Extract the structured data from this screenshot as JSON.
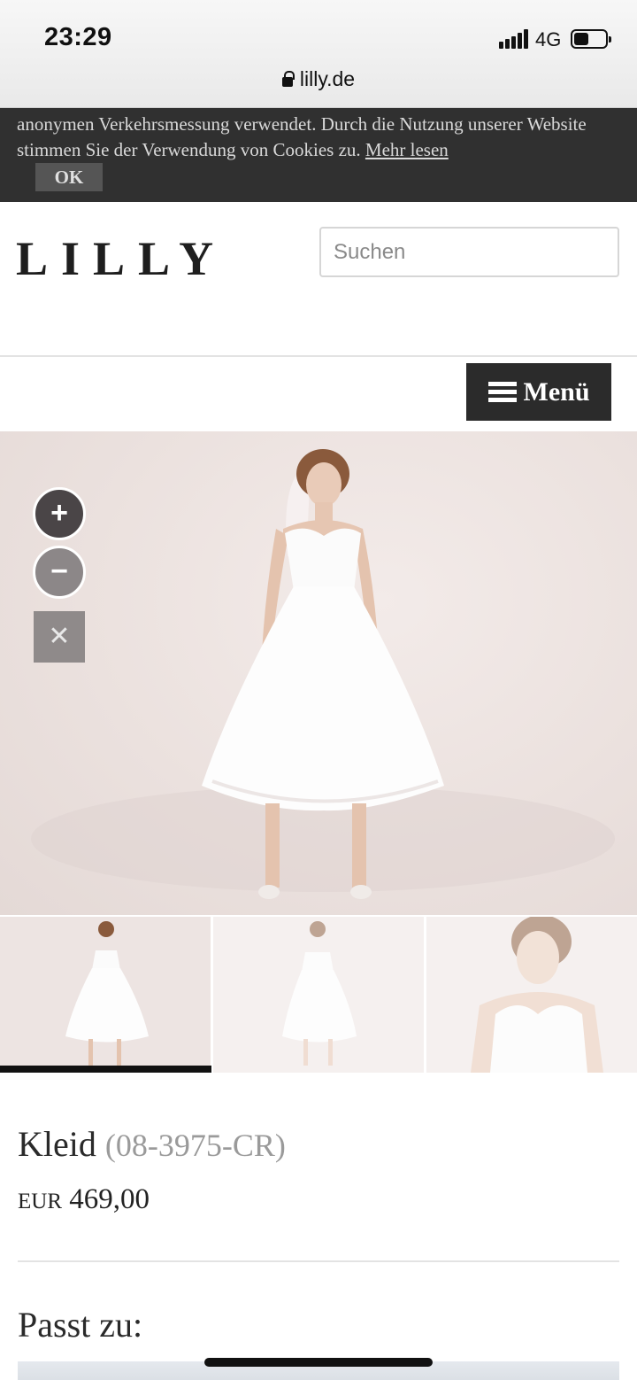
{
  "status_bar": {
    "time": "23:29",
    "network": "4G"
  },
  "browser": {
    "url": "lilly.de"
  },
  "cookie_banner": {
    "text": "anonymen Verkehrsmessung verwendet. Durch die Nutzung unserer Website stimmen Sie der Verwendung von Cookies zu.",
    "more_link": "Mehr lesen",
    "ok_label": "OK"
  },
  "header": {
    "logo": "LILLY",
    "search_placeholder": "Suchen",
    "menu_label": "Menü"
  },
  "gallery": {
    "zoom_in": "+",
    "zoom_out": "−",
    "close": "✕",
    "thumbnails": [
      "front",
      "back",
      "detail"
    ],
    "active_thumbnail": 0
  },
  "product": {
    "name": "Kleid",
    "code": "(08-3975-CR)",
    "currency": "EUR",
    "price": "469,00"
  },
  "related": {
    "heading": "Passt zu:"
  },
  "colors": {
    "banner_bg": "#303030",
    "menu_bg": "#2b2b2b",
    "accent_dark": "#111111"
  }
}
